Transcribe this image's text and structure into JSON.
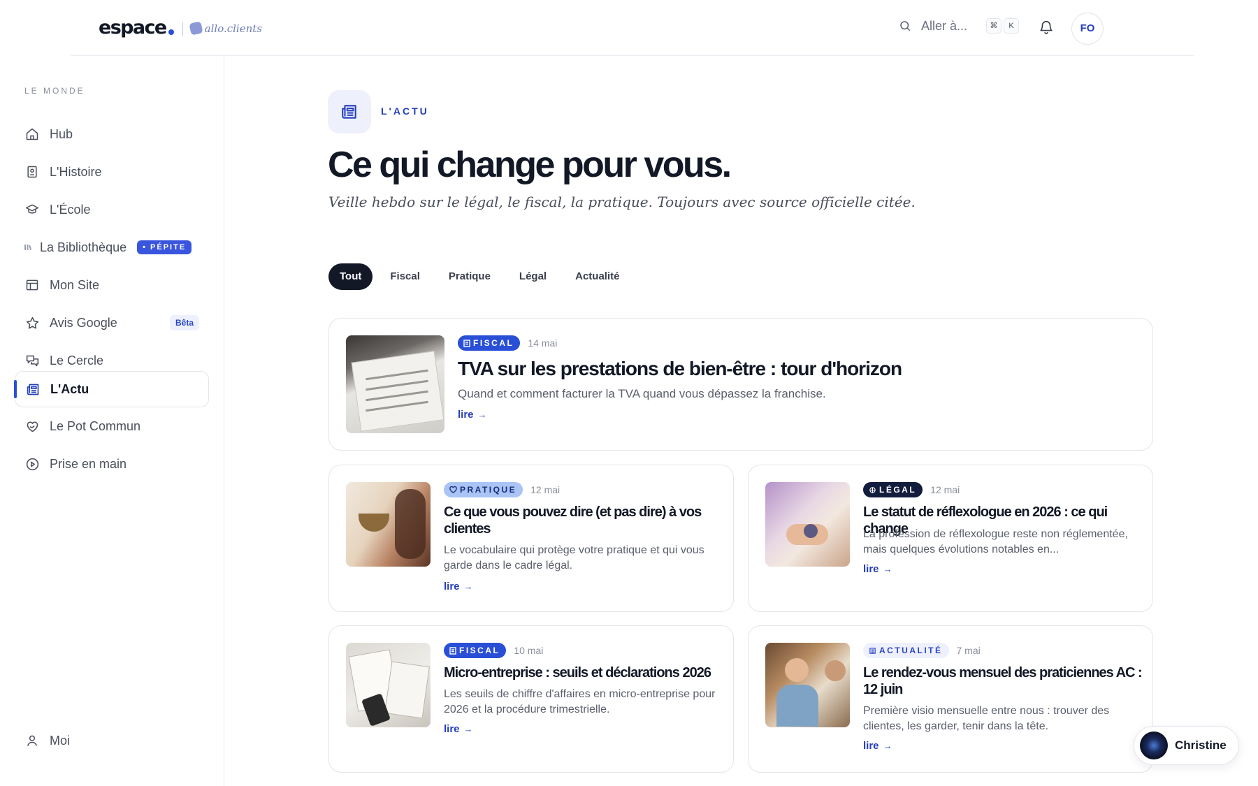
{
  "header": {
    "logo_main": "espace",
    "logo_sub": "allo.clients",
    "search_placeholder": "Aller à...",
    "kbd_cmd": "⌘",
    "kbd_k": "K",
    "avatar_initials": "FO"
  },
  "sidebar": {
    "heading": "LE MONDE",
    "items": [
      {
        "label": "Hub",
        "icon": "home-icon"
      },
      {
        "label": "L'Histoire",
        "icon": "book-icon"
      },
      {
        "label": "L'École",
        "icon": "graduation-cap-icon"
      },
      {
        "label": "La Bibliothèque",
        "icon": "library-icon",
        "badge": "PÉPITE"
      },
      {
        "label": "Mon Site",
        "icon": "layout-icon"
      },
      {
        "label": "Avis Google",
        "icon": "star-icon",
        "badge": "Bêta"
      },
      {
        "label": "Le Cercle",
        "icon": "chat-icon"
      },
      {
        "label": "L'Actu",
        "icon": "newspaper-icon",
        "active": true
      },
      {
        "label": "Le Pot Commun",
        "icon": "heart-hand-icon"
      },
      {
        "label": "Prise en main",
        "icon": "play-icon"
      }
    ],
    "footer_label": "Moi"
  },
  "main": {
    "section_label": "L'ACTU",
    "title": "Ce qui change pour vous.",
    "subtitle": "Veille hebdo sur le légal, le fiscal, la pratique. Toujours avec source officielle citée.",
    "filters": [
      "Tout",
      "Fiscal",
      "Pratique",
      "Légal",
      "Actualité"
    ],
    "active_filter": "Tout",
    "articles": [
      {
        "tag": "FISCAL",
        "date": "14 mai",
        "title": "TVA sur les prestations de bien-être : tour d'horizon",
        "desc": "Quand et comment facturer la TVA quand vous dépassez la franchise.",
        "link": "lire"
      },
      {
        "tag": "PRATIQUE",
        "date": "12 mai",
        "title": "Ce que vous pouvez dire (et pas dire) à vos clientes",
        "desc": "Le vocabulaire qui protège votre pratique et qui vous garde dans le cadre légal.",
        "link": "lire"
      },
      {
        "tag": "LÉGAL",
        "date": "12 mai",
        "title": "Le statut de réflexologue en 2026 : ce qui change",
        "desc": "La profession de réflexologue reste non réglementée, mais quelques évolutions notables en...",
        "link": "lire"
      },
      {
        "tag": "FISCAL",
        "date": "10 mai",
        "title": "Micro-entreprise : seuils et déclarations 2026",
        "desc": "Les seuils de chiffre d'affaires en micro-entreprise pour 2026 et la procédure trimestrielle.",
        "link": "lire"
      },
      {
        "tag": "ACTUALITÉ",
        "date": "7 mai",
        "title": "Le rendez-vous mensuel des praticiennes AC : 12 juin",
        "desc": "Première visio mensuelle entre nous : trouver des clientes, les garder, tenir dans la tête.",
        "link": "lire"
      }
    ]
  },
  "chat": {
    "name": "Christine"
  },
  "colors": {
    "accent": "#2a4fd7",
    "dark": "#121826",
    "border": "#e3e5eb"
  }
}
